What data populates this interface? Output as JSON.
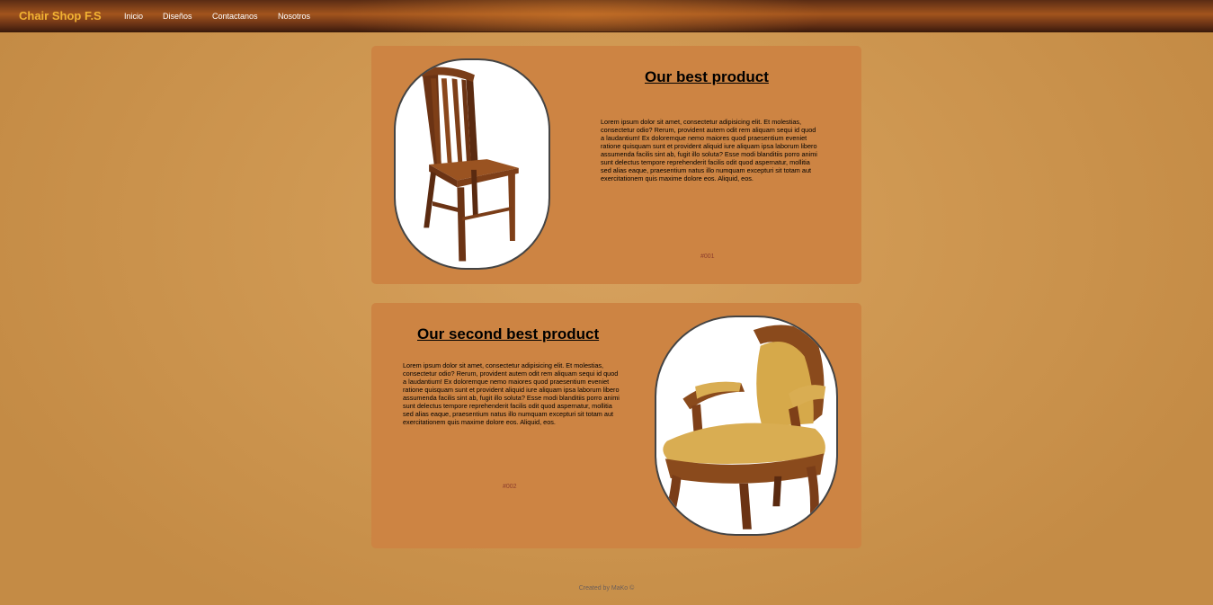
{
  "nav": {
    "brand": "Chair Shop F.S",
    "links": [
      "Inicio",
      "Diseños",
      "Contactanos",
      "Nosotros"
    ]
  },
  "products": [
    {
      "title": "Our best product",
      "description": "Lorem ipsum dolor sit amet, consectetur adipisicing elit. Et molestias, consectetur odio? Rerum, provident autem odit rem aliquam sequi id quod a laudantium! Ex doloremque nemo maiores quod praesentium eveniet ratione quisquam sunt et provident aliquid iure aliquam ipsa laborum libero assumenda facilis sint ab, fugit illo soluta? Esse modi blanditiis porro animi sunt delectus tempore reprehenderit facilis odit quod aspernatur, mollitia sed alias eaque, praesentium natus illo numquam excepturi sit totam aut exercitationem quis maxime dolore eos. Aliquid, eos.",
      "code": "#001",
      "image": "wooden-dining-chair"
    },
    {
      "title": "Our second best product",
      "description": "Lorem ipsum dolor sit amet, consectetur adipisicing elit. Et molestias, consectetur odio? Rerum, provident autem odit rem aliquam sequi id quod a laudantium! Ex doloremque nemo maiores quod praesentium eveniet ratione quisquam sunt et provident aliquid iure aliquam ipsa laborum libero assumenda facilis sint ab, fugit illo soluta? Esse modi blanditiis porro animi sunt delectus tempore reprehenderit facilis odit quod aspernatur, mollitia sed alias eaque, praesentium natus illo numquam excepturi sit totam aut exercitationem quis maxime dolore eos. Aliquid, eos.",
      "code": "#002",
      "image": "upholstered-armchair"
    }
  ],
  "footer": "Created by MaKo ©",
  "colors": {
    "brand": "#f2b233",
    "card": "#cd8443",
    "code": "#8d3d2b"
  }
}
